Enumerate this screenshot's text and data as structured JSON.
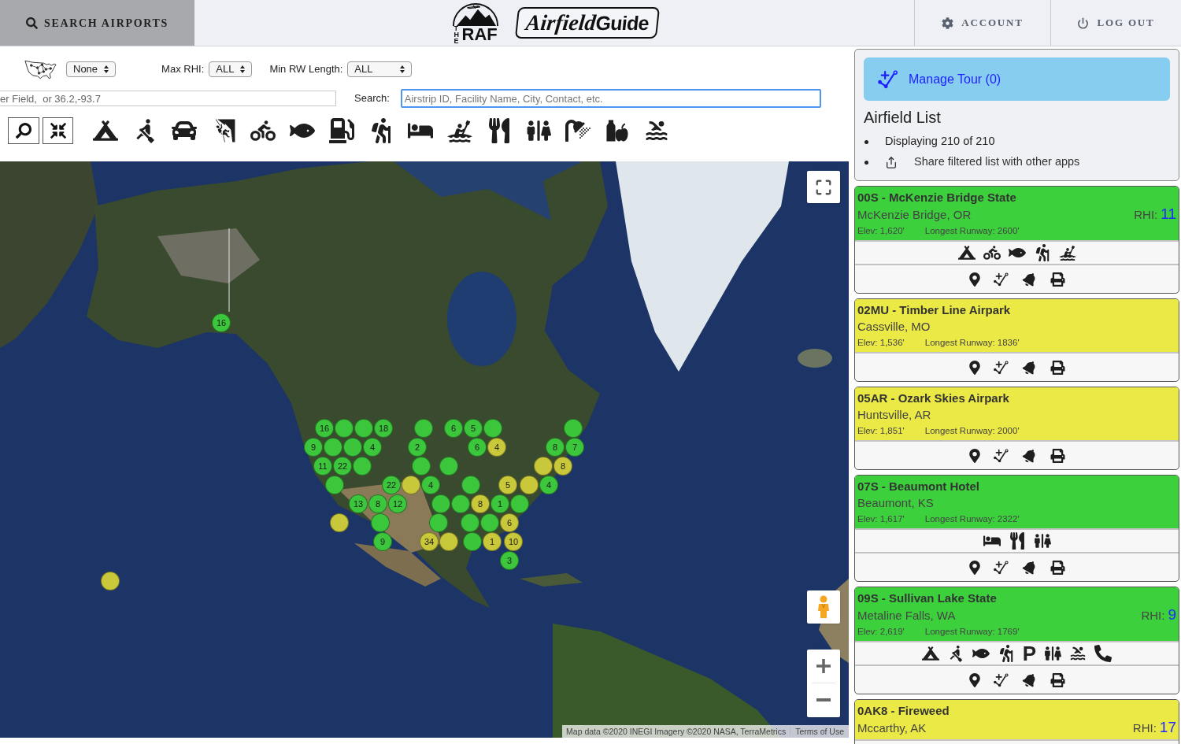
{
  "header": {
    "search_button": "SEARCH AIRPORTS",
    "logo": {
      "small": "THE",
      "mark": "RAF",
      "script": "Airfield",
      "name": "Guide"
    },
    "nav": [
      {
        "kind": "account",
        "label": "ACCOUNT"
      },
      {
        "kind": "logout",
        "label": "LOG OUT"
      }
    ]
  },
  "filters": {
    "region": {
      "value": "None"
    },
    "max_rhi": {
      "label": "Max RHI:",
      "value": "ALL"
    },
    "min_rw_length": {
      "label": "Min RW Length:",
      "value": "ALL"
    },
    "location": {
      "placeholder": "er Field,  or 36.2,-93.7"
    },
    "search": {
      "label": "Search:",
      "placeholder": "Airstrip ID, Facility Name, City, Contact, etc.",
      "focused": true
    },
    "amenities": [
      {
        "kind": "camping"
      },
      {
        "kind": "boating"
      },
      {
        "kind": "driving"
      },
      {
        "kind": "climbing"
      },
      {
        "kind": "biking"
      },
      {
        "kind": "fishing"
      },
      {
        "kind": "fuel"
      },
      {
        "kind": "hiking"
      },
      {
        "kind": "lodging"
      },
      {
        "kind": "paddling"
      },
      {
        "kind": "dining"
      },
      {
        "kind": "restrooms"
      },
      {
        "kind": "showers"
      },
      {
        "kind": "supplies"
      },
      {
        "kind": "swimming"
      }
    ]
  },
  "map": {
    "markers": [
      {
        "label": "16",
        "color": "#3cc63c"
      },
      {
        "label": "16",
        "color": "#3cc63c"
      },
      {
        "color": "#3cc63c"
      },
      {
        "color": "#3cc63c"
      },
      {
        "label": "18",
        "color": "#3cc63c"
      },
      {
        "color": "#3cc63c"
      },
      {
        "label": "6",
        "color": "#3cc63c"
      },
      {
        "label": "5",
        "color": "#3cc63c"
      },
      {
        "color": "#3cc63c"
      },
      {
        "color": "#3cc63c"
      },
      {
        "label": "9",
        "color": "#3cc63c"
      },
      {
        "color": "#3cc63c"
      },
      {
        "color": "#3cc63c"
      },
      {
        "label": "4",
        "color": "#3cc63c"
      },
      {
        "label": "2",
        "color": "#3cc63c"
      },
      {
        "label": "6",
        "color": "#3cc63c"
      },
      {
        "label": "4",
        "color": "#c9c83a"
      },
      {
        "label": "8",
        "color": "#3cc63c"
      },
      {
        "label": "7",
        "color": "#3cc63c"
      },
      {
        "label": "11",
        "color": "#3cc63c"
      },
      {
        "label": "22",
        "color": "#3cc63c"
      },
      {
        "color": "#3cc63c"
      },
      {
        "color": "#3cc63c"
      },
      {
        "color": "#3cc63c"
      },
      {
        "color": "#c9c83a"
      },
      {
        "label": "8",
        "color": "#c9c83a"
      },
      {
        "color": "#3cc63c"
      },
      {
        "label": "22",
        "color": "#3cc63c"
      },
      {
        "color": "#c9c83a"
      },
      {
        "label": "4",
        "color": "#3cc63c"
      },
      {
        "color": "#3cc63c"
      },
      {
        "label": "5",
        "color": "#c9c83a"
      },
      {
        "color": "#c9c83a"
      },
      {
        "label": "4",
        "color": "#3cc63c"
      },
      {
        "label": "13",
        "color": "#3cc63c"
      },
      {
        "label": "8",
        "color": "#3cc63c"
      },
      {
        "label": "12",
        "color": "#3cc63c"
      },
      {
        "color": "#3cc63c"
      },
      {
        "color": "#3cc63c"
      },
      {
        "label": "8",
        "color": "#c9c83a"
      },
      {
        "label": "1",
        "color": "#3cc63c"
      },
      {
        "color": "#3cc63c"
      },
      {
        "color": "#c9c83a"
      },
      {
        "color": "#3cc63c"
      },
      {
        "color": "#3cc63c"
      },
      {
        "color": "#3cc63c"
      },
      {
        "color": "#3cc63c"
      },
      {
        "label": "6",
        "color": "#c9c83a"
      },
      {
        "label": "9",
        "color": "#3cc63c"
      },
      {
        "label": "34",
        "color": "#c9c83a"
      },
      {
        "color": "#c9c83a"
      },
      {
        "color": "#3cc63c"
      },
      {
        "label": "1",
        "color": "#c9c83a"
      },
      {
        "label": "10",
        "color": "#c9c83a"
      },
      {
        "label": "3",
        "color": "#3cc63c"
      },
      {
        "color": "#c9c83a"
      }
    ],
    "attribution": "Map data ©2020 INEGI Imagery ©2020 NASA, TerraMetrics",
    "terms": "Terms of Use"
  },
  "sidebar": {
    "tour_button": "Manage Tour (0)",
    "title": "Airfield List",
    "bullets": [
      {
        "kind": "text",
        "text": "Displaying 210 of 210"
      },
      {
        "kind": "share",
        "text": "Share filtered list with other apps"
      }
    ]
  },
  "airfields": [
    {
      "title": "00S - McKenzie Bridge State",
      "location": "McKenzie Bridge, OR",
      "rhi_label": "RHI:",
      "rhi": "11",
      "elevation": "Elev: 1,620'",
      "runway": "Longest Runway: 2600'",
      "color": "#3dd03d",
      "amenities": [
        {
          "kind": "camping"
        },
        {
          "kind": "biking"
        },
        {
          "kind": "fishing"
        },
        {
          "kind": "hiking"
        },
        {
          "kind": "paddling"
        }
      ]
    },
    {
      "title": "02MU - Timber Line Airpark",
      "location": "Cassville, MO",
      "elevation": "Elev: 1,536'",
      "runway": "Longest Runway: 1836'",
      "color": "#ebe945"
    },
    {
      "title": "05AR - Ozark Skies Airpark",
      "location": "Huntsville, AR",
      "elevation": "Elev: 1,851'",
      "runway": "Longest Runway: 2000'",
      "color": "#ebe945"
    },
    {
      "title": "07S - Beaumont Hotel",
      "location": "Beaumont, KS",
      "elevation": "Elev: 1,617'",
      "runway": "Longest Runway: 2322'",
      "color": "#3dd03d",
      "amenities": [
        {
          "kind": "lodging"
        },
        {
          "kind": "dining"
        },
        {
          "kind": "restrooms"
        }
      ]
    },
    {
      "title": "09S - Sullivan Lake State",
      "location": "Metaline Falls, WA",
      "rhi_label": "RHI:",
      "rhi": "9",
      "elevation": "Elev: 2,619'",
      "runway": "Longest Runway: 1769'",
      "color": "#3dd03d",
      "amenities": [
        {
          "kind": "camping"
        },
        {
          "kind": "boating"
        },
        {
          "kind": "fishing"
        },
        {
          "kind": "hiking"
        },
        {
          "kind": "parking",
          "glyph": "P"
        },
        {
          "kind": "restrooms"
        },
        {
          "kind": "swimming"
        },
        {
          "kind": "phone"
        }
      ]
    },
    {
      "title": "0AK8 - Fireweed",
      "location": "Mccarthy, AK",
      "rhi_label": "RHI:",
      "rhi": "17",
      "color": "#ebe945"
    }
  ]
}
